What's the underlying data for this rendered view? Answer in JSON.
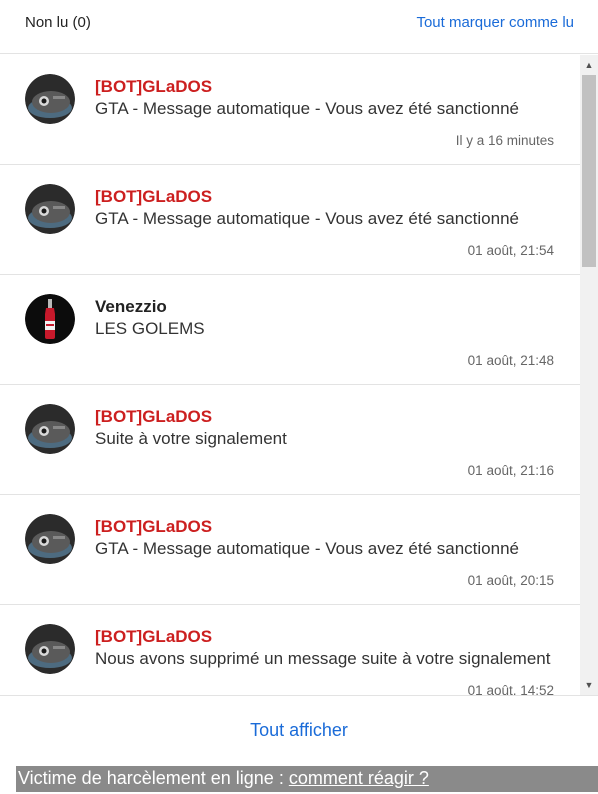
{
  "header": {
    "unread_label": "Non lu (0)",
    "mark_all_label": "Tout marquer comme lu"
  },
  "messages": [
    {
      "sender": "[BOT]GLaDOS",
      "subject": "GTA - Message automatique - Vous avez été sanctionné",
      "time": "Il y a 16 minutes",
      "avatar": "robot-eye-avatar"
    },
    {
      "sender": "[BOT]GLaDOS",
      "subject": "GTA - Message automatique - Vous avez été sanctionné",
      "time": "01 août, 21:54",
      "avatar": "robot-eye-avatar"
    },
    {
      "sender": "Venezzio",
      "subject": "LES GOLEMS",
      "time": "01 août, 21:48",
      "avatar": "bottle-avatar"
    },
    {
      "sender": "[BOT]GLaDOS",
      "subject": "Suite à votre signalement",
      "time": "01 août, 21:16",
      "avatar": "robot-eye-avatar"
    },
    {
      "sender": "[BOT]GLaDOS",
      "subject": "GTA - Message automatique - Vous avez été sanctionné",
      "time": "01 août, 20:15",
      "avatar": "robot-eye-avatar"
    },
    {
      "sender": "[BOT]GLaDOS",
      "subject": "Nous avons supprimé un message suite à votre signalement",
      "time": "01 août, 14:52",
      "avatar": "robot-eye-avatar"
    }
  ],
  "footer": {
    "show_all_label": "Tout afficher"
  },
  "banner": {
    "text": "Victime de harcèlement en ligne : ",
    "link": "comment réagir ?"
  },
  "colors": {
    "bot_name": "#cc1f1f",
    "link": "#1a6bd8",
    "banner_bg": "#8a8a8a"
  }
}
